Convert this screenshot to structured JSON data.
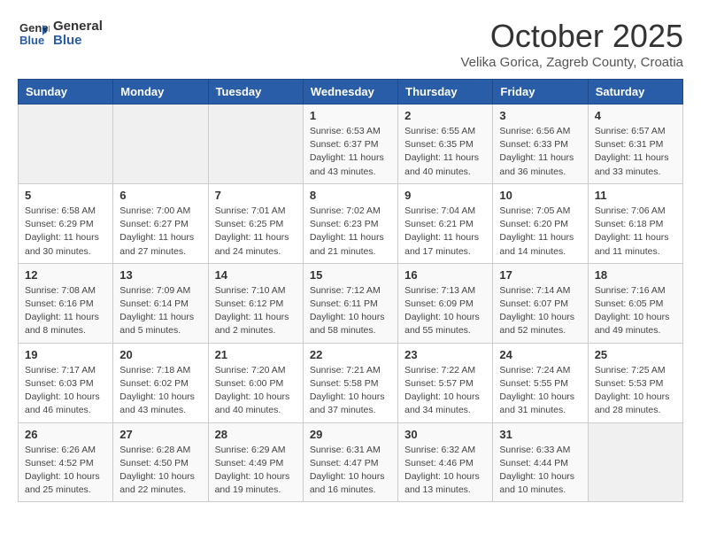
{
  "header": {
    "logo_line1": "General",
    "logo_line2": "Blue",
    "month": "October 2025",
    "location": "Velika Gorica, Zagreb County, Croatia"
  },
  "days_of_week": [
    "Sunday",
    "Monday",
    "Tuesday",
    "Wednesday",
    "Thursday",
    "Friday",
    "Saturday"
  ],
  "weeks": [
    [
      {
        "day": "",
        "info": ""
      },
      {
        "day": "",
        "info": ""
      },
      {
        "day": "",
        "info": ""
      },
      {
        "day": "1",
        "info": "Sunrise: 6:53 AM\nSunset: 6:37 PM\nDaylight: 11 hours and 43 minutes."
      },
      {
        "day": "2",
        "info": "Sunrise: 6:55 AM\nSunset: 6:35 PM\nDaylight: 11 hours and 40 minutes."
      },
      {
        "day": "3",
        "info": "Sunrise: 6:56 AM\nSunset: 6:33 PM\nDaylight: 11 hours and 36 minutes."
      },
      {
        "day": "4",
        "info": "Sunrise: 6:57 AM\nSunset: 6:31 PM\nDaylight: 11 hours and 33 minutes."
      }
    ],
    [
      {
        "day": "5",
        "info": "Sunrise: 6:58 AM\nSunset: 6:29 PM\nDaylight: 11 hours and 30 minutes."
      },
      {
        "day": "6",
        "info": "Sunrise: 7:00 AM\nSunset: 6:27 PM\nDaylight: 11 hours and 27 minutes."
      },
      {
        "day": "7",
        "info": "Sunrise: 7:01 AM\nSunset: 6:25 PM\nDaylight: 11 hours and 24 minutes."
      },
      {
        "day": "8",
        "info": "Sunrise: 7:02 AM\nSunset: 6:23 PM\nDaylight: 11 hours and 21 minutes."
      },
      {
        "day": "9",
        "info": "Sunrise: 7:04 AM\nSunset: 6:21 PM\nDaylight: 11 hours and 17 minutes."
      },
      {
        "day": "10",
        "info": "Sunrise: 7:05 AM\nSunset: 6:20 PM\nDaylight: 11 hours and 14 minutes."
      },
      {
        "day": "11",
        "info": "Sunrise: 7:06 AM\nSunset: 6:18 PM\nDaylight: 11 hours and 11 minutes."
      }
    ],
    [
      {
        "day": "12",
        "info": "Sunrise: 7:08 AM\nSunset: 6:16 PM\nDaylight: 11 hours and 8 minutes."
      },
      {
        "day": "13",
        "info": "Sunrise: 7:09 AM\nSunset: 6:14 PM\nDaylight: 11 hours and 5 minutes."
      },
      {
        "day": "14",
        "info": "Sunrise: 7:10 AM\nSunset: 6:12 PM\nDaylight: 11 hours and 2 minutes."
      },
      {
        "day": "15",
        "info": "Sunrise: 7:12 AM\nSunset: 6:11 PM\nDaylight: 10 hours and 58 minutes."
      },
      {
        "day": "16",
        "info": "Sunrise: 7:13 AM\nSunset: 6:09 PM\nDaylight: 10 hours and 55 minutes."
      },
      {
        "day": "17",
        "info": "Sunrise: 7:14 AM\nSunset: 6:07 PM\nDaylight: 10 hours and 52 minutes."
      },
      {
        "day": "18",
        "info": "Sunrise: 7:16 AM\nSunset: 6:05 PM\nDaylight: 10 hours and 49 minutes."
      }
    ],
    [
      {
        "day": "19",
        "info": "Sunrise: 7:17 AM\nSunset: 6:03 PM\nDaylight: 10 hours and 46 minutes."
      },
      {
        "day": "20",
        "info": "Sunrise: 7:18 AM\nSunset: 6:02 PM\nDaylight: 10 hours and 43 minutes."
      },
      {
        "day": "21",
        "info": "Sunrise: 7:20 AM\nSunset: 6:00 PM\nDaylight: 10 hours and 40 minutes."
      },
      {
        "day": "22",
        "info": "Sunrise: 7:21 AM\nSunset: 5:58 PM\nDaylight: 10 hours and 37 minutes."
      },
      {
        "day": "23",
        "info": "Sunrise: 7:22 AM\nSunset: 5:57 PM\nDaylight: 10 hours and 34 minutes."
      },
      {
        "day": "24",
        "info": "Sunrise: 7:24 AM\nSunset: 5:55 PM\nDaylight: 10 hours and 31 minutes."
      },
      {
        "day": "25",
        "info": "Sunrise: 7:25 AM\nSunset: 5:53 PM\nDaylight: 10 hours and 28 minutes."
      }
    ],
    [
      {
        "day": "26",
        "info": "Sunrise: 6:26 AM\nSunset: 4:52 PM\nDaylight: 10 hours and 25 minutes."
      },
      {
        "day": "27",
        "info": "Sunrise: 6:28 AM\nSunset: 4:50 PM\nDaylight: 10 hours and 22 minutes."
      },
      {
        "day": "28",
        "info": "Sunrise: 6:29 AM\nSunset: 4:49 PM\nDaylight: 10 hours and 19 minutes."
      },
      {
        "day": "29",
        "info": "Sunrise: 6:31 AM\nSunset: 4:47 PM\nDaylight: 10 hours and 16 minutes."
      },
      {
        "day": "30",
        "info": "Sunrise: 6:32 AM\nSunset: 4:46 PM\nDaylight: 10 hours and 13 minutes."
      },
      {
        "day": "31",
        "info": "Sunrise: 6:33 AM\nSunset: 4:44 PM\nDaylight: 10 hours and 10 minutes."
      },
      {
        "day": "",
        "info": ""
      }
    ]
  ]
}
